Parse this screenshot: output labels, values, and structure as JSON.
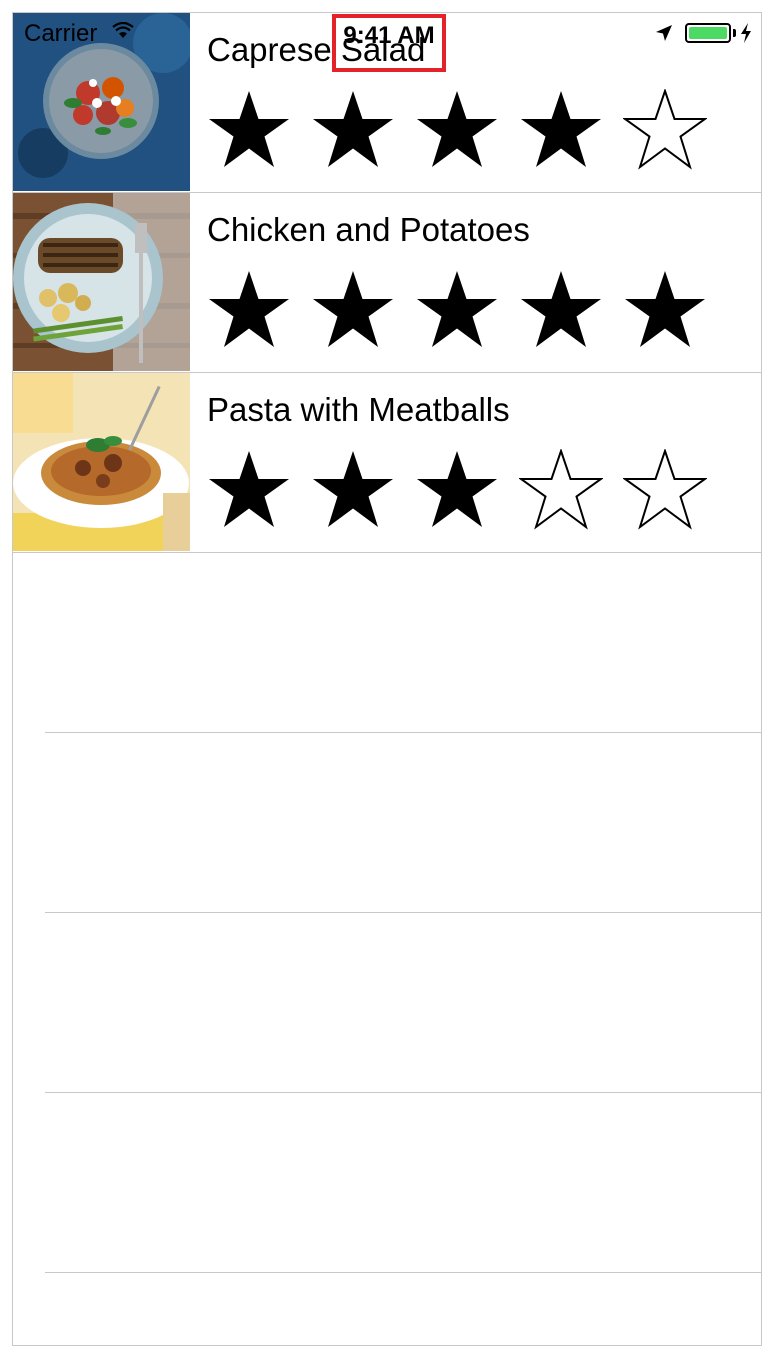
{
  "status_bar": {
    "carrier": "Carrier",
    "time": "9:41 AM",
    "battery_level": 1.0,
    "battery_color": "#4cd964"
  },
  "meals": [
    {
      "name": "Caprese Salad",
      "rating": 4,
      "max_rating": 5,
      "photo": "caprese-salad-photo"
    },
    {
      "name": "Chicken and Potatoes",
      "rating": 5,
      "max_rating": 5,
      "photo": "chicken-potatoes-photo"
    },
    {
      "name": "Pasta with Meatballs",
      "rating": 3,
      "max_rating": 5,
      "photo": "pasta-meatballs-photo"
    }
  ],
  "empty_rows": 4,
  "colors": {
    "highlight_box": "#e3222a",
    "separator": "#c8c7cc"
  }
}
